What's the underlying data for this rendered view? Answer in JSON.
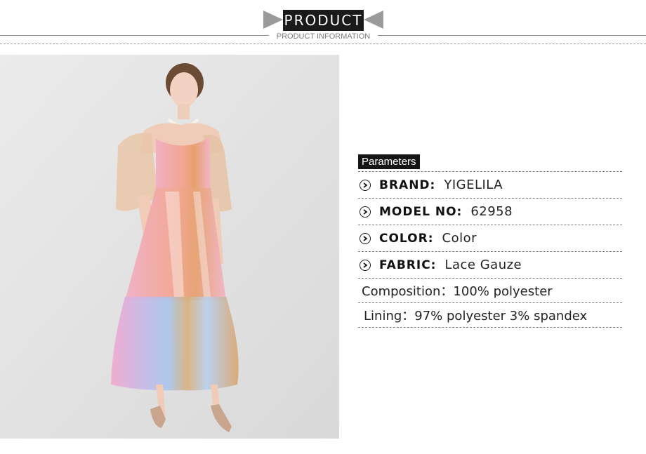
{
  "header": {
    "title": "PRODUCT",
    "subtitle": "PRODUCT INFORMATION"
  },
  "params": {
    "heading": "Parameters",
    "rows": [
      {
        "icon": "chevron-right-circle-icon",
        "key": "BRAND:",
        "value": "YIGELILA"
      },
      {
        "icon": "chevron-right-circle-icon",
        "key": "MODEL NO:",
        "value": "62958"
      },
      {
        "icon": "chevron-right-circle-icon",
        "key": "COLOR:",
        "value": "Color"
      },
      {
        "icon": "chevron-right-circle-icon",
        "key": "FABRIC:",
        "value": "Lace Gauze"
      }
    ],
    "composition": "Composition：100% polyester",
    "lining": "Lining：97% polyester 3% spandex"
  },
  "colors": {
    "accent": "#1a1a1a",
    "rule": "#8a8a8a",
    "photo_bg": "#e2e2e2"
  }
}
